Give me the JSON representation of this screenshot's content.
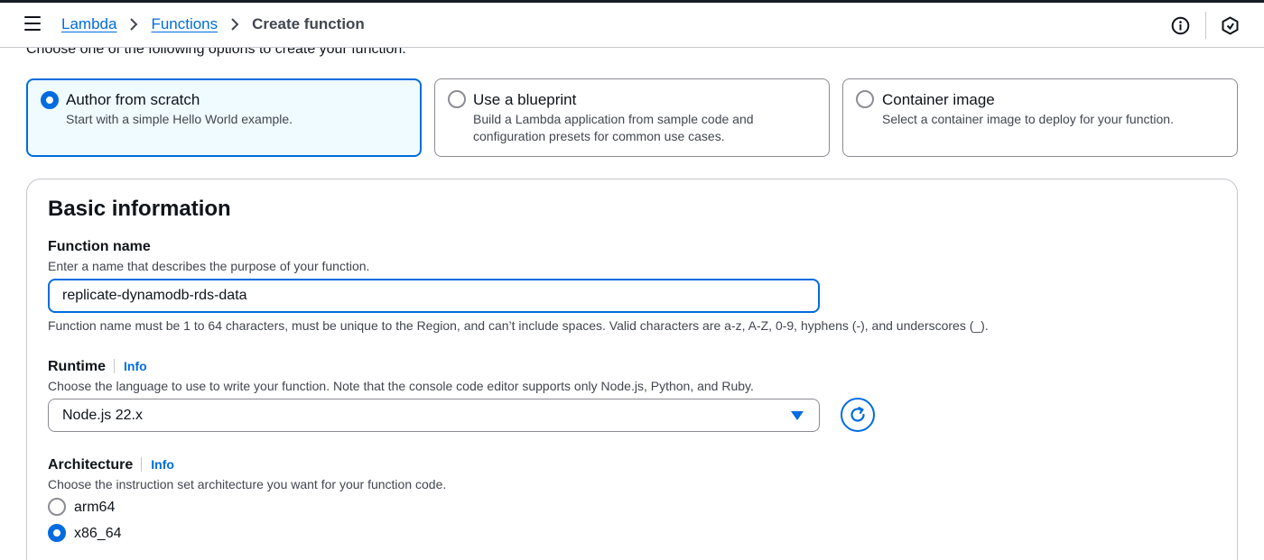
{
  "header": {
    "breadcrumbs": [
      {
        "label": "Lambda"
      },
      {
        "label": "Functions"
      },
      {
        "label": "Create function"
      }
    ]
  },
  "intro_text": "Choose one of the following options to create your function.",
  "options": [
    {
      "title": "Author from scratch",
      "desc": "Start with a simple Hello World example.",
      "selected": true
    },
    {
      "title": "Use a blueprint",
      "desc": "Build a Lambda application from sample code and configuration presets for common use cases.",
      "selected": false
    },
    {
      "title": "Container image",
      "desc": "Select a container image to deploy for your function.",
      "selected": false
    }
  ],
  "basic_info": {
    "title": "Basic information",
    "function_name": {
      "label": "Function name",
      "description": "Enter a name that describes the purpose of your function.",
      "value": "replicate-dynamodb-rds-data",
      "constraint": "Function name must be 1 to 64 characters, must be unique to the Region, and can’t include spaces. Valid characters are a-z, A-Z, 0-9, hyphens (-), and underscores (_)."
    },
    "runtime": {
      "label": "Runtime",
      "info": "Info",
      "description": "Choose the language to use to write your function. Note that the console code editor supports only Node.js, Python, and Ruby.",
      "selected": "Node.js 22.x"
    },
    "architecture": {
      "label": "Architecture",
      "info": "Info",
      "description": "Choose the instruction set architecture you want for your function code.",
      "options": [
        {
          "label": "arm64",
          "checked": false
        },
        {
          "label": "x86_64",
          "checked": true
        }
      ]
    }
  },
  "colors": {
    "accent": "#006ce0",
    "selected_bg": "#f0fbff",
    "text": "#0f141a",
    "secondary_text": "#424650",
    "border": "#8c8c94"
  },
  "icons": [
    "menu-icon",
    "chevron-right-icon",
    "info-icon",
    "hexagon-icon",
    "caret-down-icon",
    "refresh-icon"
  ]
}
